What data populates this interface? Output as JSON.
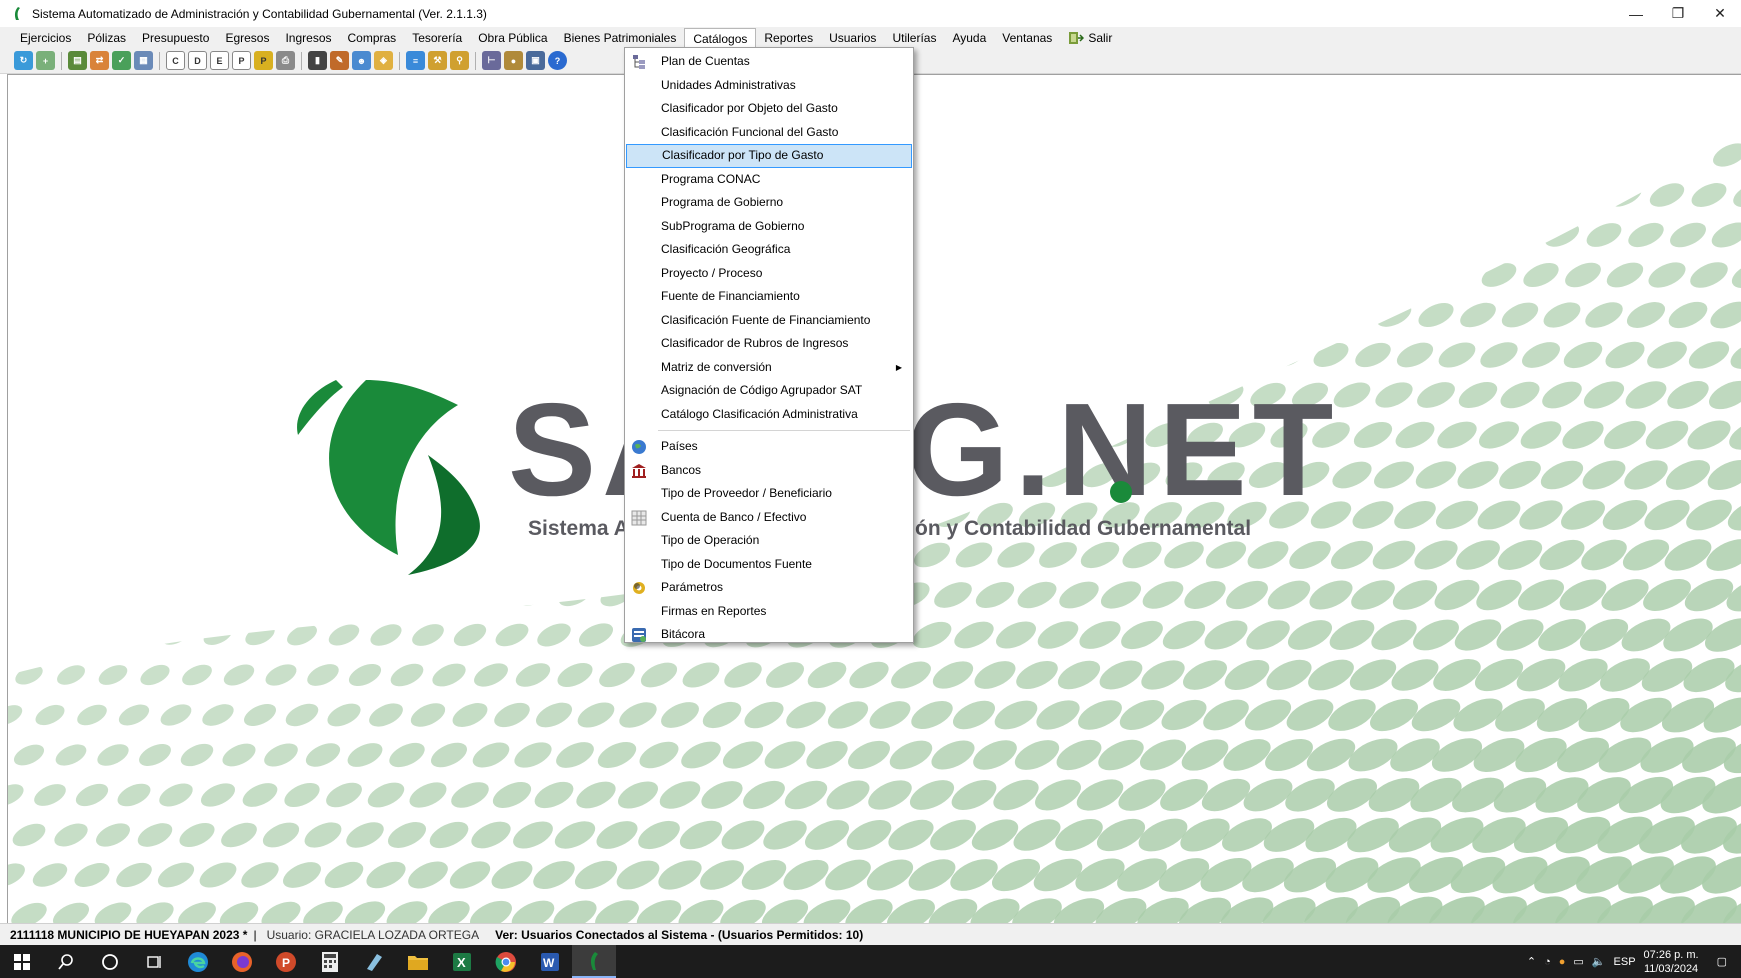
{
  "window": {
    "title": "Sistema Automatizado de Administración y Contabilidad Gubernamental  (Ver. 2.1.1.3)",
    "minimize_glyph": "—",
    "restore_glyph": "❐",
    "close_glyph": "✕"
  },
  "menubar": {
    "items": [
      "Ejercicios",
      "Pólizas",
      "Presupuesto",
      "Egresos",
      "Ingresos",
      "Compras",
      "Tesorería",
      "Obra Pública",
      "Bienes Patrimoniales",
      "Catálogos",
      "Reportes",
      "Usuarios",
      "Utilerías",
      "Ayuda",
      "Ventanas"
    ],
    "exit_label": "Salir",
    "active_index": 9
  },
  "catalogos_menu": {
    "group1": [
      "Plan de Cuentas",
      "Unidades Administrativas",
      "Clasificador por Objeto del Gasto",
      "Clasificación Funcional del Gasto",
      "Clasificador por Tipo de Gasto",
      "Programa CONAC",
      "Programa de Gobierno",
      "SubPrograma de Gobierno",
      "Clasificación Geográfica",
      "Proyecto / Proceso",
      "Fuente de Financiamiento",
      "Clasificación Fuente de Financiamiento",
      "Clasificador de Rubros de Ingresos",
      "Matriz de conversión",
      "Asignación de Código Agrupador SAT",
      "Catálogo Clasificación Administrativa"
    ],
    "group2": [
      "Países",
      "Bancos",
      "Tipo de Proveedor / Beneficiario",
      "Cuenta de Banco / Efectivo",
      "Tipo de Operación",
      "Tipo de Documentos Fuente",
      "Parámetros",
      "Firmas en Reportes",
      "Bitácora"
    ],
    "highlighted": "Clasificador por Tipo de Gasto",
    "submenu_item": "Matriz de conversión"
  },
  "logo": {
    "text": "SAACG.NET",
    "subtitle": "Sistema Automatizado de Administración y Contabilidad Gubernamental",
    "colors": {
      "green": "#1a8a3a",
      "dark_green": "#0f6e2c",
      "gray": "#5a5a60"
    }
  },
  "statusbar": {
    "entity": "2111118 MUNICIPIO DE HUEYAPAN  2023   *",
    "user": "Usuario: GRACIELA LOZADA ORTEGA",
    "connected": "Ver: Usuarios Conectados al Sistema - (Usuarios Permitidos: 10)"
  },
  "taskbar": {
    "apps": [
      "start-icon",
      "search-icon",
      "cortana-icon",
      "task-view-icon",
      "edge-icon",
      "firefox-icon",
      "powerpoint-icon",
      "calculator-icon",
      "notes-icon",
      "file-explorer-icon",
      "excel-icon",
      "chrome-icon",
      "word-icon",
      "saacg-icon"
    ],
    "language": "ESP",
    "time": "07:26 p. m.",
    "date": "11/03/2024"
  }
}
